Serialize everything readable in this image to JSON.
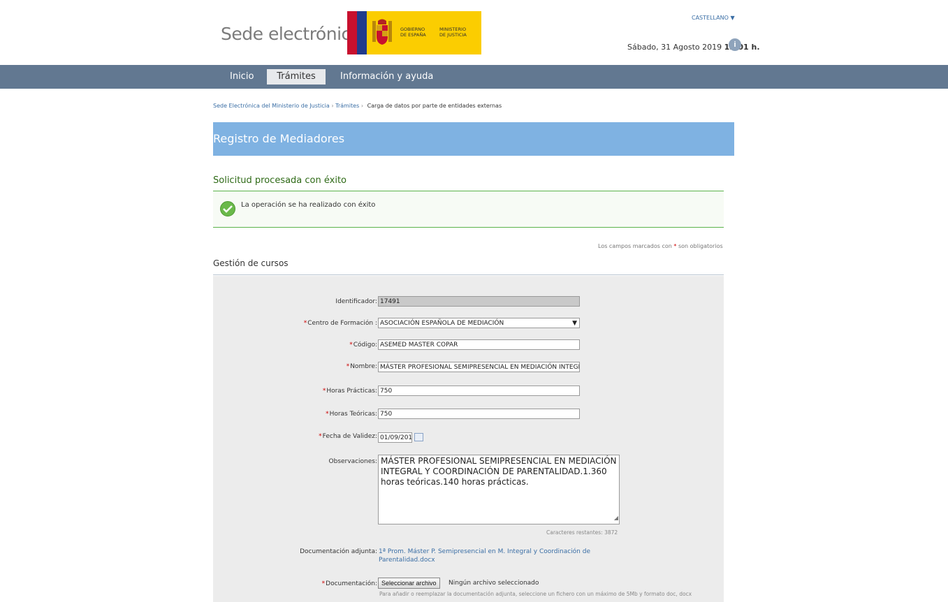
{
  "header": {
    "site_title": "Sede electrónica",
    "logo": {
      "text_gov": "GOBIERNO\nDE ESPAÑA",
      "text_min": "MINISTERIO\nDE JUSTICIA"
    },
    "language": "CASTELLANO ▼",
    "date_text": "Sábado, 31 Agosto 2019",
    "time_text": "13:01 h.",
    "info_icon": "i"
  },
  "nav": {
    "items": [
      {
        "label": "Inicio",
        "active": false
      },
      {
        "label": "Trámites",
        "active": true
      },
      {
        "label": "Información y ayuda",
        "active": false
      }
    ]
  },
  "breadcrumb": {
    "items": [
      "Sede Electrónica del Ministerio de Justicia",
      "Trámites"
    ],
    "separator": "›",
    "current": "Carga de datos por parte de entidades externas"
  },
  "banner": {
    "title": "Registro de Mediadores"
  },
  "success": {
    "title": "Solicitud procesada con éxito",
    "message": "La operación se ha realizado con éxito"
  },
  "required_note": {
    "before": "Los campos marcados con",
    "star": "*",
    "after": "son obligatorios"
  },
  "section": {
    "title": "Gestión de cursos"
  },
  "form": {
    "required_mark": "*",
    "identificador": {
      "label": "Identificador:",
      "value": "17491"
    },
    "centro": {
      "label": "Centro de Formación :",
      "value": "ASOCIACIÓN ESPAÑOLA DE MEDIACIÓN",
      "arrow": "▼"
    },
    "codigo": {
      "label": "Código:",
      "value": "ASEMED MASTER COPAR"
    },
    "nombre": {
      "label": "Nombre:",
      "value": "MÁSTER PROFESIONAL SEMIPRESENCIAL EN MEDIACIÓN INTEGR"
    },
    "horas_practicas": {
      "label": "Horas Prácticas:",
      "value": "750"
    },
    "horas_teoricas": {
      "label": "Horas Teóricas:",
      "value": "750"
    },
    "fecha": {
      "label": "Fecha de Validez:",
      "value": "01/09/201"
    },
    "observaciones": {
      "label": "Observaciones:",
      "value": "MÁSTER PROFESIONAL SEMIPRESENCIAL EN MEDIACIÓN INTEGRAL Y COORDINACIÓN DE PARENTALIDAD.1.360 horas teóricas.140 horas prácticas.",
      "chars_remaining": "Caracteres restantes: 3872"
    },
    "doc_adjunta": {
      "label": "Documentación adjunta:",
      "link": "1ª Prom. Máster P. Semipresencial en M. Integral y Coordinación de Parentalidad.docx"
    },
    "documentacion": {
      "label": "Documentación:",
      "button": "Seleccionar archivo",
      "no_file": "Ningún archivo seleccionado",
      "help": "Para añadir o reemplazar la documentación adjunta, seleccione un fichero con un máximo de 5Mb y formato doc, docx"
    }
  },
  "colors": {
    "nav_bg": "#627891",
    "banner_bg": "#7fb2e2",
    "success_green": "#5cb34b",
    "link_blue": "#3a6ea5",
    "required_red": "#cc0000"
  }
}
